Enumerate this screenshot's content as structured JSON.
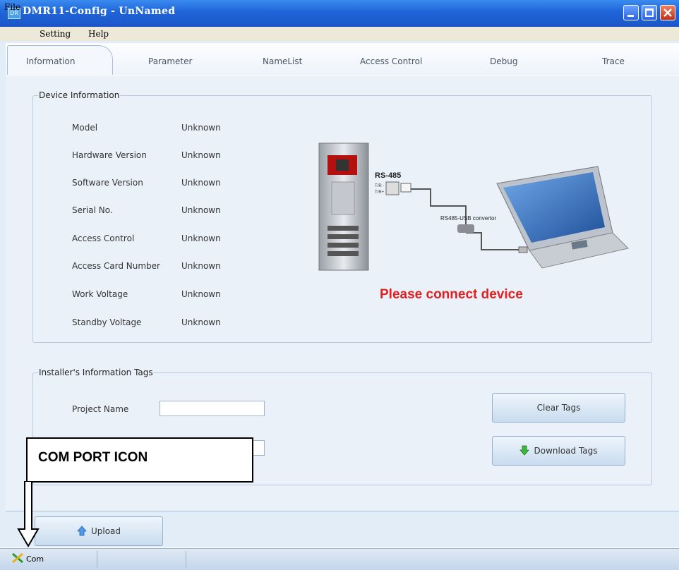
{
  "window": {
    "title": "DMR11-Config - UnNamed",
    "app_icon_text": "DR"
  },
  "menu": [
    "File",
    "Setting",
    "Help"
  ],
  "tabs": [
    "Information",
    "Parameter",
    "NameList",
    "Access Control",
    "Debug",
    "Trace"
  ],
  "device_info": {
    "legend": "Device Information",
    "rows": [
      {
        "label": "Model",
        "value": "Unknown"
      },
      {
        "label": "Hardware Version",
        "value": "Unknown"
      },
      {
        "label": "Software Version",
        "value": "Unknown"
      },
      {
        "label": "Serial No.",
        "value": "Unknown"
      },
      {
        "label": "Access Control",
        "value": "Unknown"
      },
      {
        "label": "Access Card Number",
        "value": "Unknown"
      },
      {
        "label": "Work Voltage",
        "value": "Unknown"
      },
      {
        "label": "Standby Voltage",
        "value": "Unknown"
      }
    ],
    "diagram": {
      "rs485": "RS-485",
      "tr_minus": "T/R -",
      "tr_plus": "T/R+",
      "convertor": "RS485-USB convertor"
    },
    "message": "Please connect device"
  },
  "installer": {
    "legend": "Installer's Information Tags",
    "project_name_label": "Project Name",
    "project_name_value": "",
    "second_field_value": "",
    "clear_button": "Clear Tags",
    "download_button": "Download Tags"
  },
  "upload_button": "Upload",
  "status": {
    "com": "Com"
  },
  "annotation": {
    "text": "COM PORT ICON"
  },
  "colors": {
    "message": "#e41f1f",
    "title_bar": "#1f64d8",
    "panel": "#eaf1f9"
  }
}
